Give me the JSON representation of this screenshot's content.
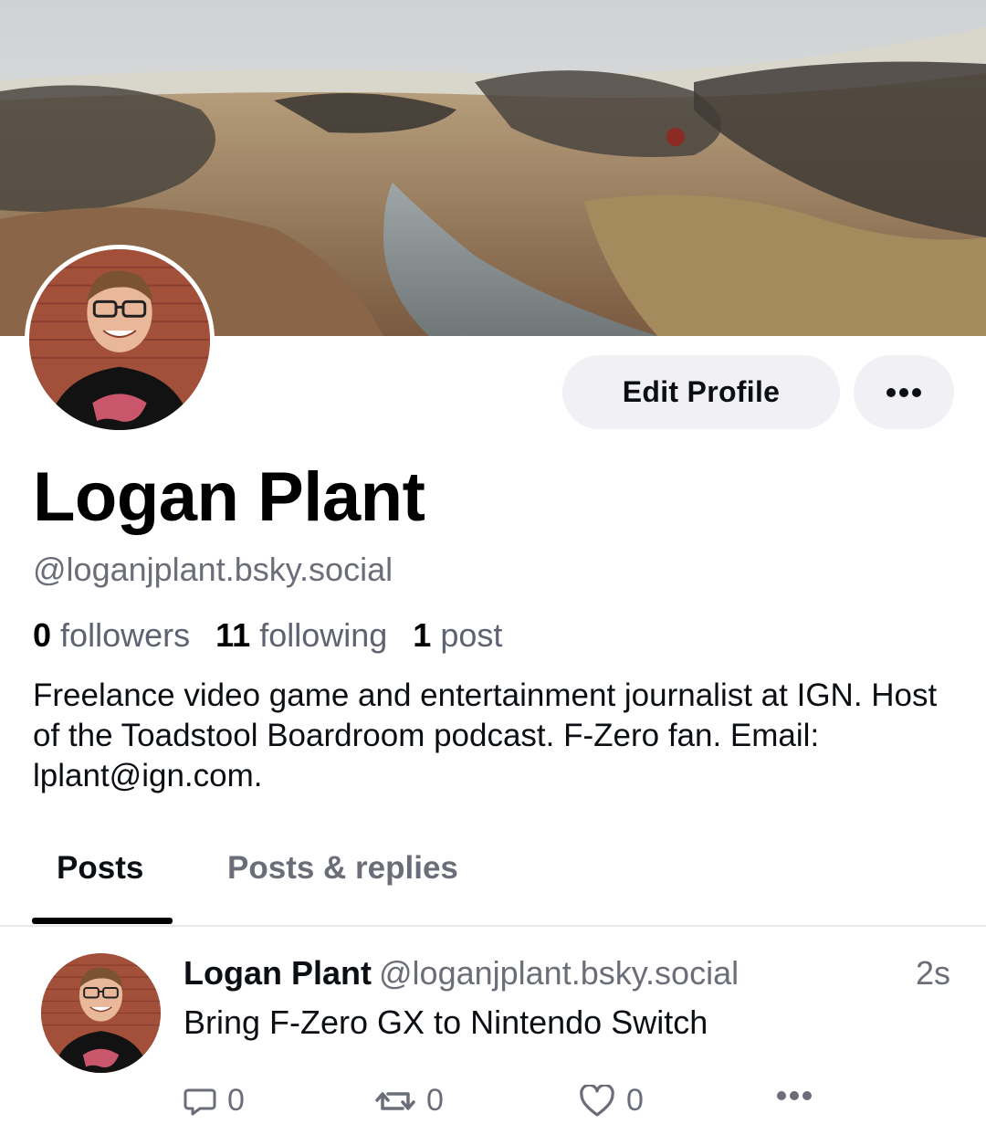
{
  "profile": {
    "display_name": "Logan Plant",
    "handle": "@loganjplant.bsky.social",
    "followers_count": "0",
    "followers_label": "followers",
    "following_count": "11",
    "following_label": "following",
    "posts_count": "1",
    "posts_label": "post",
    "bio": "Freelance video game and entertainment journalist at IGN. Host of the Toadstool Boardroom podcast. F-Zero fan. Email: lplant@ign.com."
  },
  "buttons": {
    "edit_profile": "Edit Profile"
  },
  "tabs": [
    {
      "label": "Posts",
      "active": true
    },
    {
      "label": "Posts & replies",
      "active": false
    }
  ],
  "posts": [
    {
      "author": "Logan Plant",
      "handle": "@loganjplant.bsky.social",
      "time": "2s",
      "text": "Bring F-Zero GX to Nintendo Switch",
      "reply_count": "0",
      "repost_count": "0",
      "like_count": "0"
    }
  ],
  "icons": {
    "more": "ellipsis-icon",
    "reply": "speech-bubble-icon",
    "repost": "repost-arrows-icon",
    "like": "heart-icon",
    "post_more": "ellipsis-icon"
  },
  "colors": {
    "button_bg": "#f1f1f5",
    "muted_text": "#6b6e79",
    "tab_indicator": "#000000"
  }
}
